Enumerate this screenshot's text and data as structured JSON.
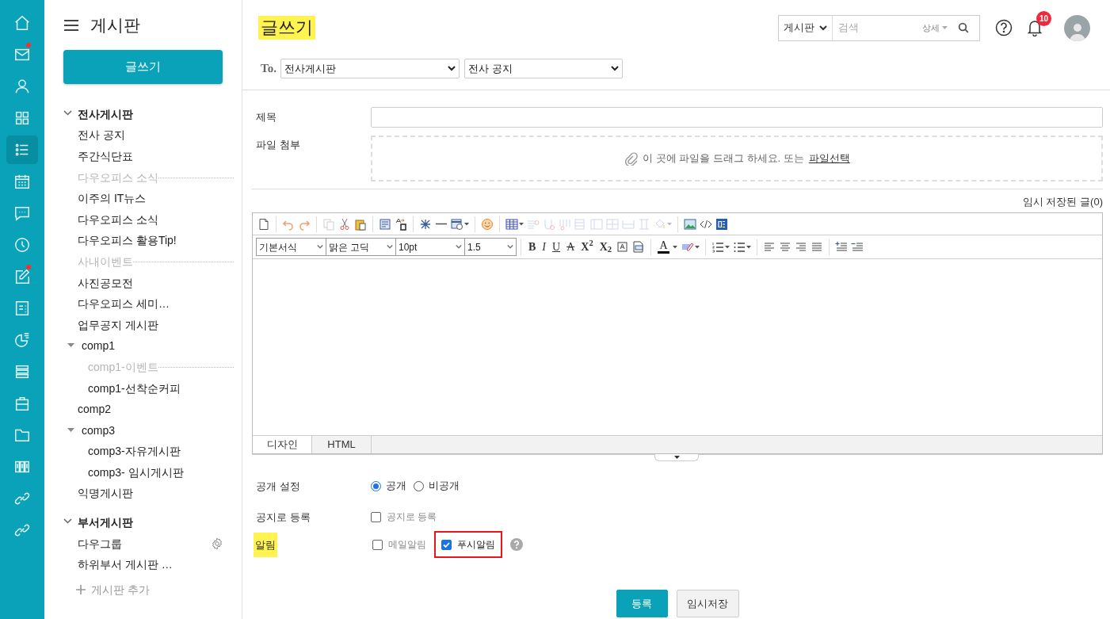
{
  "rail": [
    {
      "selected": false,
      "dot": false
    },
    {
      "selected": false,
      "dot": true
    },
    {
      "selected": false,
      "dot": false
    },
    {
      "selected": false,
      "dot": false
    },
    {
      "selected": true,
      "dot": false
    },
    {
      "selected": false,
      "dot": false
    },
    {
      "selected": false,
      "dot": false
    },
    {
      "selected": false,
      "dot": false
    },
    {
      "selected": false,
      "dot": true
    },
    {
      "selected": false,
      "dot": false
    },
    {
      "selected": false,
      "dot": false
    },
    {
      "selected": false,
      "dot": false
    },
    {
      "selected": false,
      "dot": false
    },
    {
      "selected": false,
      "dot": false
    },
    {
      "selected": false,
      "dot": false
    },
    {
      "selected": false,
      "dot": false
    },
    {
      "selected": false,
      "dot": false
    }
  ],
  "sidebar": {
    "title": "게시판",
    "write_button": "글쓰기",
    "sections": [
      {
        "label": "전사게시판",
        "expanded": true,
        "children": [
          {
            "label": "전사 공지",
            "kind": "board"
          },
          {
            "label": "주간식단표",
            "kind": "board"
          },
          {
            "label": "다우오피스 소식",
            "kind": "category"
          },
          {
            "label": "이주의 IT뉴스",
            "kind": "board"
          },
          {
            "label": "다우오피스 소식",
            "kind": "board"
          },
          {
            "label": "다우오피스 활용Tip!",
            "kind": "board"
          },
          {
            "label": "사내이벤트",
            "kind": "category"
          },
          {
            "label": "사진공모전",
            "kind": "board"
          },
          {
            "label": "다우오피스 세미…",
            "kind": "board"
          },
          {
            "label": "업무공지 게시판",
            "kind": "board"
          },
          {
            "label": "comp1",
            "kind": "group",
            "expanded": true,
            "children": [
              {
                "label": "comp1-이벤트",
                "kind": "category"
              },
              {
                "label": "comp1-선착순커피",
                "kind": "board"
              }
            ]
          },
          {
            "label": "comp2",
            "kind": "board"
          },
          {
            "label": "comp3",
            "kind": "group",
            "expanded": true,
            "children": [
              {
                "label": "comp3-자유게시판",
                "kind": "board"
              },
              {
                "label": "comp3- 임시게시판",
                "kind": "board"
              }
            ]
          },
          {
            "label": "익명게시판",
            "kind": "board"
          }
        ]
      },
      {
        "label": "부서게시판",
        "expanded": true,
        "children": [
          {
            "label": "다우그룹",
            "kind": "managed"
          },
          {
            "label": "하위부서 게시판 …",
            "kind": "board"
          }
        ]
      }
    ],
    "add_board": "게시판 추가"
  },
  "header": {
    "title": "글쓰기",
    "title_highlighted": true,
    "search": {
      "scope": "게시판",
      "placeholder": "검색",
      "detail": "상세"
    },
    "notification_count": "10"
  },
  "to": {
    "label": "To.",
    "selects": [
      "전사게시판",
      "전사 공지"
    ]
  },
  "form": {
    "subject_label": "제목",
    "attach_label": "파일 첨부",
    "drop_text": "이 곳에 파일을 드래그 하세요. 또는",
    "drop_link": "파일선택"
  },
  "editor": {
    "drafts": "임시 저장된 글(0)",
    "selects": [
      "기본서식",
      "맑은 고딕",
      "10pt",
      "1.5"
    ],
    "format_buttons": [
      {
        "label": "B",
        "kind": "bold"
      },
      {
        "label": "I",
        "kind": "italic"
      },
      {
        "label": "U",
        "kind": "underline"
      },
      {
        "label": "A",
        "kind": "strike"
      },
      {
        "label": "X$^{2}$",
        "kind": "sup"
      },
      {
        "label": "X$_{2}$",
        "kind": "sub"
      }
    ],
    "text_color": "A",
    "tabs": [
      {
        "label": "디자인",
        "selected": true
      },
      {
        "label": "HTML",
        "selected": false
      }
    ]
  },
  "options": {
    "visibility": {
      "label": "공개 설정",
      "choices": [
        {
          "label": "공개",
          "selected": true
        },
        {
          "label": "비공개",
          "selected": false
        }
      ]
    },
    "notice": {
      "label": "공지로 등록",
      "checkbox": {
        "label": "공지로 등록",
        "checked": false
      }
    },
    "alert": {
      "label": "알림",
      "highlighted": true,
      "checkboxes": [
        {
          "label": "메일알림",
          "checked": false,
          "highlighted": false
        },
        {
          "label": "푸시알림",
          "checked": true,
          "highlighted": true
        }
      ]
    }
  },
  "buttons": [
    {
      "label": "등록",
      "kind": "primary"
    },
    {
      "label": "임시저장",
      "kind": "secondary"
    }
  ]
}
